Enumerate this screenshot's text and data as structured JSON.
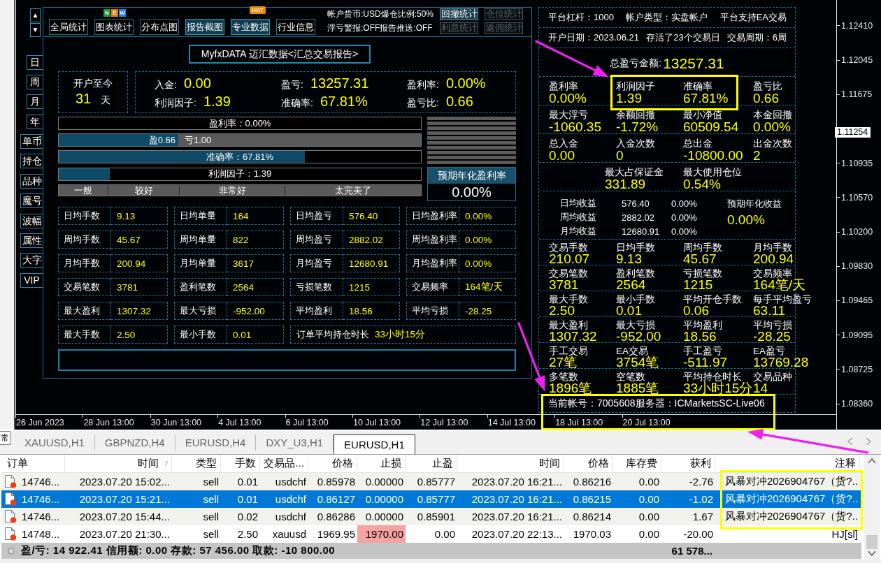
{
  "side_panel": {
    "scroll_arrows": [
      "▲",
      "▼"
    ],
    "periods": [
      "日",
      "周",
      "月",
      "年"
    ],
    "views": [
      "单币",
      "持仓",
      "品种",
      "魔号",
      "波幅",
      "属性",
      "大字",
      "VIP"
    ]
  },
  "toolbar": {
    "buttons": [
      {
        "label": "全局统计",
        "selected": false
      },
      {
        "label": "图表统计",
        "selected": false,
        "badge": {
          "kind": "new",
          "letters": [
            {
              "text": "N",
              "color": "#1e9a3a"
            },
            {
              "text": "E",
              "color": "#f07800"
            },
            {
              "text": "W",
              "color": "#1a86e0"
            }
          ]
        }
      },
      {
        "label": "分布点图",
        "selected": false
      },
      {
        "label": "报告截图",
        "selected": true
      },
      {
        "label": "专业数据",
        "selected": true,
        "badge": {
          "kind": "hot",
          "letters": [
            {
              "text": "HOT",
              "color": "#f08a00"
            }
          ]
        }
      },
      {
        "label": "行业信息",
        "selected": false
      }
    ],
    "status_lines": [
      "帐户货币:USD爆仓比例:50%",
      "浮亏警报:OFF报告推送:OFF"
    ],
    "stat_buttons": [
      {
        "label": "回撤统计",
        "disabled": false
      },
      {
        "label": "仓位统计",
        "disabled": true
      },
      {
        "label": "利息统计",
        "disabled": true
      },
      {
        "label": "返佣统计",
        "disabled": true
      }
    ]
  },
  "report_title": "MyfxDATA 迈汇数据<汇总交易报告>",
  "since_open": {
    "label": "开户至今",
    "value": "31",
    "unit": "天"
  },
  "summary": [
    {
      "label": "入金:",
      "value": "0.00"
    },
    {
      "label": "盈亏:",
      "value": "13257.31"
    },
    {
      "label": "盈利率:",
      "value": "0.00%"
    },
    {
      "label": "利润因子:",
      "value": "1.39"
    },
    {
      "label": "准确率:",
      "value": "67.81%"
    },
    {
      "label": "盈亏比:",
      "value": "0.66"
    }
  ],
  "bars": [
    {
      "kind": "single",
      "text": "盈利率：0.00%"
    },
    {
      "kind": "split",
      "profit": "盈0.66",
      "loss": "亏1.00",
      "level": 0.33
    },
    {
      "kind": "single",
      "text": "准确率：67.81%",
      "level": 0.68
    },
    {
      "kind": "single",
      "text": "利润因子：1.39",
      "level": 0.14
    }
  ],
  "rating_scale": [
    "一般",
    "较好",
    "非常好",
    "太完美了"
  ],
  "annual_rate": {
    "title": "预期年化盈利率",
    "value": "0.00%"
  },
  "stats_grid": [
    [
      {
        "kind": "pair",
        "label": "日均手数",
        "value": "9.13"
      },
      {
        "kind": "pair",
        "label": "日均单量",
        "value": "164"
      },
      {
        "kind": "pair",
        "label": "日均盈亏",
        "value": "576.40"
      },
      {
        "kind": "pair",
        "label": "日均盈利率",
        "value": "0.00%"
      }
    ],
    [
      {
        "kind": "pair",
        "label": "周均手数",
        "value": "45.67"
      },
      {
        "kind": "pair",
        "label": "周均单量",
        "value": "822"
      },
      {
        "kind": "pair",
        "label": "周均盈亏",
        "value": "2882.02"
      },
      {
        "kind": "pair",
        "label": "周均盈利率",
        "value": "0.00%"
      }
    ],
    [
      {
        "kind": "pair",
        "label": "月均手数",
        "value": "200.94"
      },
      {
        "kind": "pair",
        "label": "月均单量",
        "value": "3617"
      },
      {
        "kind": "pair",
        "label": "月均盈亏",
        "value": "12680.91"
      },
      {
        "kind": "pair",
        "label": "月均盈利率",
        "value": "0.00%"
      }
    ],
    [
      {
        "kind": "pair",
        "label": "交易笔数",
        "value": "3781"
      },
      {
        "kind": "pair",
        "label": "盈利笔数",
        "value": "2564"
      },
      {
        "kind": "pair",
        "label": "亏损笔数",
        "value": "1215"
      },
      {
        "kind": "pair",
        "label": "交易频率",
        "value": "164笔/天"
      }
    ],
    [
      {
        "kind": "pair",
        "label": "最大盈利",
        "value": "1307.32"
      },
      {
        "kind": "pair",
        "label": "最大亏损",
        "value": "-952.00"
      },
      {
        "kind": "pair",
        "label": "平均盈利",
        "value": "18.56"
      },
      {
        "kind": "pair",
        "label": "平均亏损",
        "value": "-28.25"
      }
    ],
    [
      {
        "kind": "pair",
        "label": "最大手数",
        "value": "2.50"
      },
      {
        "kind": "pair",
        "label": "最小手数",
        "value": "0.01"
      },
      {
        "kind": "wide",
        "label": "订单平均持仓时长",
        "value": "33小时15分"
      }
    ]
  ],
  "overview": {
    "info_lines": [
      [
        "平台杠杆：1000",
        "帐户类型：实盘帐户",
        "平台支持EA交易"
      ],
      [
        "开户日期：2023.06.21",
        "存活了23个交易日",
        "交易周期：6周"
      ]
    ],
    "total": {
      "label": "总盈亏金额:",
      "value": "13257.31"
    },
    "metric_rows": [
      {
        "kind": "quad",
        "items": [
          {
            "label": "盈利率",
            "value": "0.00%"
          },
          {
            "label": "利润因子",
            "value": "1.39"
          },
          {
            "label": "准确率",
            "value": "67.81%"
          },
          {
            "label": "盈亏比",
            "value": "0.66"
          }
        ]
      },
      {
        "kind": "quad",
        "items": [
          {
            "label": "最大浮亏",
            "value": "-1060.35"
          },
          {
            "label": "余额回撤",
            "value": "-1.72%"
          },
          {
            "label": "最小净值",
            "value": "60509.54"
          },
          {
            "label": "本金回撤",
            "value": "0.00%"
          }
        ]
      },
      {
        "kind": "quad",
        "items": [
          {
            "label": "总入金",
            "value": "0.00"
          },
          {
            "label": "入金次数",
            "value": "0"
          },
          {
            "label": "总出金",
            "value": "-10800.00"
          },
          {
            "label": "出金次数",
            "value": "2"
          }
        ]
      },
      {
        "kind": "pair",
        "items": [
          {
            "label": "最大占保证金",
            "value": "331.89"
          },
          {
            "label": "最大使用仓位",
            "value": "0.54%"
          }
        ]
      }
    ],
    "income": {
      "rows": [
        {
          "label": "日均收益",
          "amount": "576.40",
          "rate": "0.00%"
        },
        {
          "label": "周均收益",
          "amount": "2882.02",
          "rate": "0.00%"
        },
        {
          "label": "月均收益",
          "amount": "12680.91",
          "rate": "0.00%"
        }
      ],
      "annual": {
        "label": "预期年化收益",
        "value": "0.00%"
      }
    },
    "trade_rows": [
      [
        {
          "label": "交易手数",
          "value": "210.07"
        },
        {
          "label": "日均手数",
          "value": "9.13"
        },
        {
          "label": "周均手数",
          "value": "45.67"
        },
        {
          "label": "月均手数",
          "value": "200.94"
        }
      ],
      [
        {
          "label": "交易笔数",
          "value": "3781"
        },
        {
          "label": "盈利笔数",
          "value": "2564"
        },
        {
          "label": "亏损笔数",
          "value": "1215"
        },
        {
          "label": "交易频率",
          "value": "164笔/天"
        }
      ],
      [
        {
          "label": "最大手数",
          "value": "2.50"
        },
        {
          "label": "最小手数",
          "value": "0.01"
        },
        {
          "label": "平均开仓手数",
          "value": "0.06"
        },
        {
          "label": "每手平均盈亏",
          "value": "63.11"
        }
      ],
      [
        {
          "label": "最大盈利",
          "value": "1307.32"
        },
        {
          "label": "最大亏损",
          "value": "-952.00"
        },
        {
          "label": "平均盈利",
          "value": "18.56"
        },
        {
          "label": "平均亏损",
          "value": "-28.25"
        }
      ],
      [
        {
          "label": "手工交易",
          "value": "27笔"
        },
        {
          "label": "EA交易",
          "value": "3754笔"
        },
        {
          "label": "手工盈亏",
          "value": "-511.97"
        },
        {
          "label": "EA盈亏",
          "value": "13769.28"
        }
      ],
      [
        {
          "label": "多笔数",
          "value": "1896笔"
        },
        {
          "label": "空笔数",
          "value": "1885笔"
        },
        {
          "label": "平均持仓时长",
          "value": "33小时15分"
        },
        {
          "label": "交易品种",
          "value": "14"
        }
      ]
    ],
    "account": {
      "account": "当前帐号：7005608",
      "server": "服务器：ICMarketsSC-Live06"
    }
  },
  "price_axis": [
    {
      "kind": "tick",
      "label": "1.12410"
    },
    {
      "kind": "tick",
      "label": "1.12045"
    },
    {
      "kind": "tick",
      "label": "1.11675"
    },
    {
      "kind": "current",
      "label": "1.11254"
    },
    {
      "kind": "tick",
      "label": "1.10935"
    },
    {
      "kind": "tick",
      "label": "1.10570"
    },
    {
      "kind": "tick",
      "label": "1.10200"
    },
    {
      "kind": "tick",
      "label": "1.09830"
    },
    {
      "kind": "tick",
      "label": "1.09465"
    },
    {
      "kind": "tick",
      "label": "1.09095"
    },
    {
      "kind": "tick",
      "label": "1.08725"
    },
    {
      "kind": "tick",
      "label": "1.08360"
    }
  ],
  "time_axis": [
    "26 Jun 2023",
    "28 Jun 13:00",
    "30 Jun 13:00",
    "4 Jul 13:00",
    "6 Jul 13:00",
    "10 Jul 13:00",
    "12 Jul 13:00",
    "14 Jul 13:00",
    "18 Jul 13:00",
    "20 Jul 13:00"
  ],
  "terminal": {
    "side_tab": "常",
    "tabs": [
      {
        "label": "XAUUSD,H1",
        "selected": false
      },
      {
        "label": "GBPNZD,H4",
        "selected": false
      },
      {
        "label": "EURUSD,H4",
        "selected": false
      },
      {
        "label": "DXY_U3,H1",
        "selected": false
      },
      {
        "label": "EURUSD,H1",
        "selected": true
      }
    ],
    "columns": [
      {
        "label": "订单",
        "sorted": false
      },
      {
        "label": "时间",
        "sorted": true
      },
      {
        "label": "类型",
        "sorted": false
      },
      {
        "label": "手数",
        "sorted": false
      },
      {
        "label": "交易品...",
        "sorted": false
      },
      {
        "label": "价格",
        "sorted": false
      },
      {
        "label": "止损",
        "sorted": false
      },
      {
        "label": "止盈",
        "sorted": false
      },
      {
        "label": "时间",
        "sorted": false
      },
      {
        "label": "价格",
        "sorted": false
      },
      {
        "label": "库存费",
        "sorted": false
      },
      {
        "label": "获利",
        "sorted": false
      },
      {
        "label": "注释",
        "sorted": false
      }
    ],
    "rows": [
      {
        "selected": false,
        "stop_loss_hit": false,
        "cells": [
          "14746...",
          "2023.07.20 15:02...",
          "sell",
          "0.01",
          "usdchf",
          "0.85978",
          "0.00000",
          "0.85777",
          "2023.07.20 16:21...",
          "0.86216",
          "0.00",
          "-2.76",
          "风暴对冲2026904767（货?.."
        ]
      },
      {
        "selected": true,
        "stop_loss_hit": false,
        "cells": [
          "14746...",
          "2023.07.20 15:21...",
          "sell",
          "0.01",
          "usdchf",
          "0.86127",
          "0.00000",
          "0.85777",
          "2023.07.20 16:21...",
          "0.86215",
          "0.00",
          "-1.02",
          "风暴对冲2026904767（货?.."
        ]
      },
      {
        "selected": false,
        "stop_loss_hit": false,
        "cells": [
          "14746...",
          "2023.07.20 15:44...",
          "sell",
          "0.02",
          "usdchf",
          "0.86286",
          "0.00000",
          "0.85901",
          "2023.07.20 16:21...",
          "0.86214",
          "0.00",
          "1.67",
          "风暴对冲2026904767（货?.."
        ]
      },
      {
        "selected": false,
        "stop_loss_hit": true,
        "cells": [
          "14748...",
          "2023.07.20 21:30...",
          "sell",
          "2.50",
          "xauusd",
          "1969.95",
          "1970.00",
          "0.00",
          "2023.07.20 22:13...",
          "1970.03",
          "0.00",
          "-20.00",
          "HJ[sl]"
        ]
      }
    ],
    "footer": {
      "summary": "盈/亏: 14 922.41 信用额: 0.00 存款: 57 456.00 取款: -10 800.00",
      "total": "61 578..."
    }
  }
}
